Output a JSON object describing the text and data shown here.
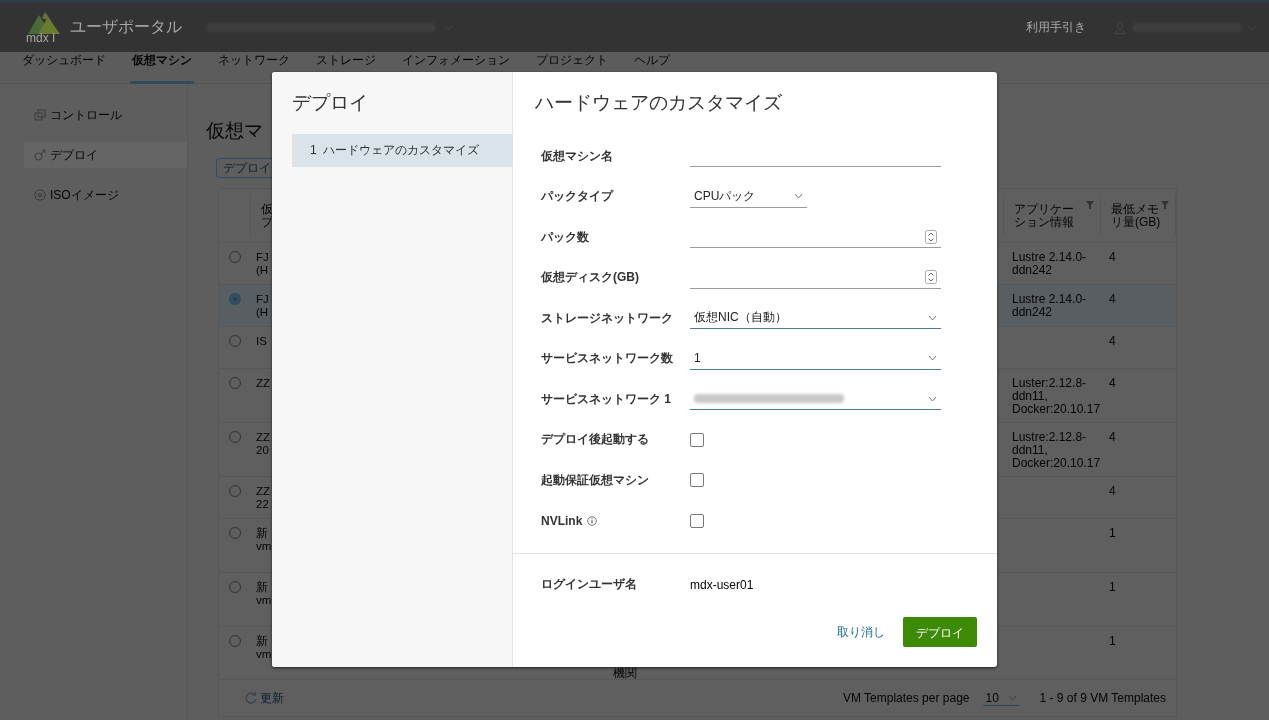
{
  "header": {
    "logo_text": "mdx I",
    "title": "ユーザポータル",
    "help_link": "利用手引き"
  },
  "nav_tabs": [
    {
      "label": "ダッシュボード",
      "selected": false
    },
    {
      "label": "仮想マシン",
      "selected": true
    },
    {
      "label": "ネットワーク",
      "selected": false
    },
    {
      "label": "ストレージ",
      "selected": false
    },
    {
      "label": "インフォメーション",
      "selected": false
    },
    {
      "label": "プロジェクト",
      "selected": false
    },
    {
      "label": "ヘルプ",
      "selected": false
    }
  ],
  "sidebar": {
    "items": [
      {
        "label": "コントロール",
        "kind": "control",
        "selected": false
      },
      {
        "label": "デプロイ",
        "kind": "deploy",
        "selected": true
      },
      {
        "label": "ISOイメージ",
        "kind": "disc",
        "selected": false
      }
    ]
  },
  "page": {
    "title": "仮想マ",
    "deploy_button": "デプロイ"
  },
  "table": {
    "columns": [
      {
        "lines": [
          "仮",
          "プ"
        ],
        "filterable": false
      },
      {
        "lines": [
          "アプリケー",
          "ション情報"
        ],
        "filterable": true
      },
      {
        "lines": [
          "最低メモ",
          "リ量(GB)"
        ],
        "filterable": true
      }
    ],
    "rows": [
      {
        "selected": false,
        "name": [
          "FJ",
          "(H"
        ],
        "app": [
          "Lustre 2.14.0-",
          "ddn242"
        ],
        "memory": "4"
      },
      {
        "selected": true,
        "name": [
          "FJ",
          "(H"
        ],
        "app": [
          "Lustre 2.14.0-",
          "ddn242"
        ],
        "memory": "4"
      },
      {
        "selected": false,
        "name": [
          "IS"
        ],
        "memory": "4"
      },
      {
        "selected": false,
        "name": [
          "ZZ"
        ],
        "app": [
          "Luster:2.12.8-",
          "ddn11,",
          "Docker:20.10.17"
        ],
        "memory": "4"
      },
      {
        "selected": false,
        "name": [
          "ZZ",
          "20"
        ],
        "app": [
          "Lustre:2.12.8-",
          "ddn11,",
          "Docker:20.10.17"
        ],
        "memory": "4"
      },
      {
        "selected": false,
        "name": [
          "ZZ",
          "22"
        ],
        "memory": "4"
      },
      {
        "selected": false,
        "name": [
          "新",
          "vm"
        ],
        "memory": "1"
      },
      {
        "selected": false,
        "name": [
          "新",
          "vm"
        ],
        "memory": "1"
      },
      {
        "selected": false,
        "name": [
          "新",
          "vm"
        ],
        "column_3": "機関",
        "memory": "1"
      }
    ],
    "footer": {
      "refresh": "更新",
      "per_page_label": "VM Templates per page",
      "per_page": "10",
      "range": "1 - 9 of 9 VM Templates"
    }
  },
  "modal": {
    "title": "デプロイ",
    "steps": [
      {
        "number": "1",
        "label": "ハードウェアのカスタマイズ",
        "selected": true
      }
    ],
    "section_title": "ハードウェアのカスタマイズ",
    "fields": [
      {
        "kind": "text",
        "label": "仮想マシン名",
        "highlighted": false
      },
      {
        "kind": "select",
        "label": "パックタイプ",
        "value": "CPUパック",
        "compact": true,
        "highlighted": false
      },
      {
        "kind": "number",
        "label": "パック数",
        "highlighted": false
      },
      {
        "kind": "number",
        "label": "仮想ディスク(GB)",
        "highlighted": false
      },
      {
        "kind": "select",
        "label": "ストレージネットワーク",
        "value": "仮想NIC（自動）",
        "highlighted": true
      },
      {
        "kind": "select",
        "label": "サービスネットワーク数",
        "value": "1",
        "highlighted": true
      },
      {
        "kind": "select",
        "label": "サービスネットワーク 1",
        "redacted": true,
        "highlighted": true
      },
      {
        "kind": "checkbox",
        "label": "デプロイ後起動する",
        "checked": false
      },
      {
        "kind": "checkbox",
        "label": "起動保証仮想マシン",
        "checked": false
      },
      {
        "kind": "checkbox",
        "label": "NVLink",
        "info": true,
        "checked": false
      }
    ],
    "login": {
      "label": "ログインユーザ名",
      "value": "mdx-user01"
    },
    "cancel": "取り消し",
    "submit": "デプロイ"
  }
}
